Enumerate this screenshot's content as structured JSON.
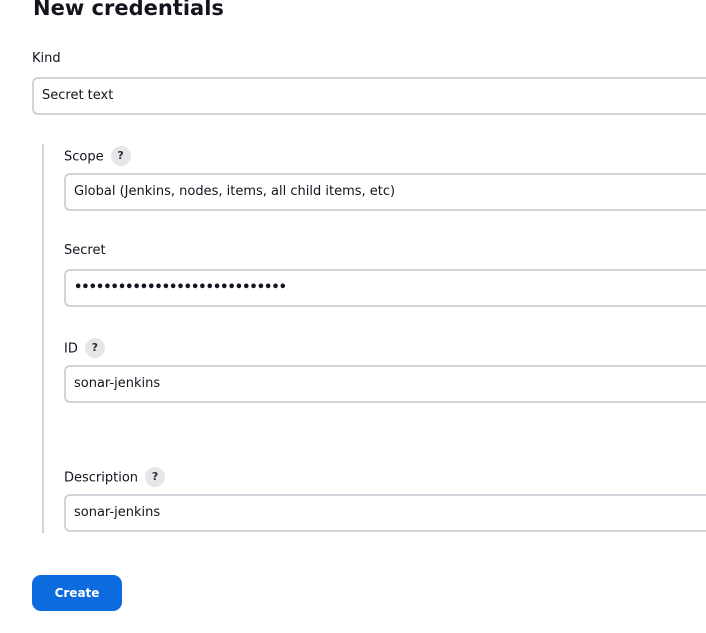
{
  "page": {
    "title": "New credentials"
  },
  "kind": {
    "label": "Kind",
    "value": "Secret text"
  },
  "scope": {
    "label": "Scope",
    "help": "?",
    "value": "Global (Jenkins, nodes, items, all child items, etc)"
  },
  "secret": {
    "label": "Secret",
    "value": "•••••••••••••••••••••••••••••"
  },
  "id": {
    "label": "ID",
    "help": "?",
    "value": "sonar-jenkins"
  },
  "description": {
    "label": "Description",
    "help": "?",
    "value": "sonar-jenkins"
  },
  "actions": {
    "create_label": "Create"
  },
  "colors": {
    "primary_button": "#0b6bdf",
    "input_border": "#cfd3da",
    "help_badge": "#e5e6e8"
  }
}
